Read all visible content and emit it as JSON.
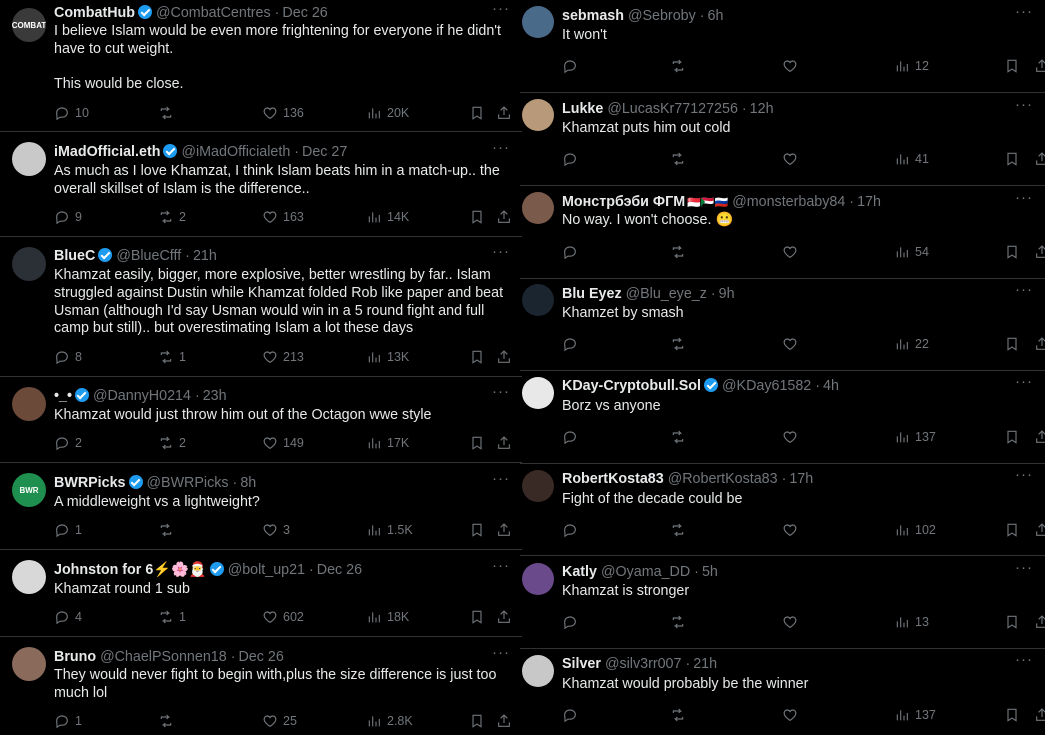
{
  "left_tweets": [
    {
      "name": "CombatHub",
      "verified": true,
      "handle": "@CombatCentres",
      "time": "Dec 26",
      "text": "I believe Islam would be even more frightening for everyone if he didn't have to cut weight.\n\nThis would be close.",
      "replies": "10",
      "retweets": "",
      "likes": "136",
      "views": "20K",
      "avatar_color": "#3a3a3a",
      "avatar_label": "COMBAT"
    },
    {
      "name": "iMadOfficial.eth",
      "verified": true,
      "handle": "@iMadOfficialeth",
      "time": "Dec 27",
      "text": "As much as I love Khamzat, I think Islam beats him in a match-up.. the overall skillset of Islam is the difference..",
      "replies": "9",
      "retweets": "2",
      "likes": "163",
      "views": "14K",
      "avatar_color": "#c9c9c9",
      "avatar_label": ""
    },
    {
      "name": "BlueC",
      "verified": true,
      "handle": "@BlueCfff",
      "time": "21h",
      "text": "Khamzat easily, bigger, more explosive, better wrestling by far.. Islam struggled against Dustin while Khamzat folded Rob like paper and beat Usman (although I'd say Usman would win in a 5 round fight and full camp but still).. but overestimating Islam a lot these days",
      "replies": "8",
      "retweets": "1",
      "likes": "213",
      "views": "13K",
      "avatar_color": "#2b2f36",
      "avatar_label": ""
    },
    {
      "name": "•_•",
      "verified": true,
      "handle": "@DannyH0214",
      "time": "23h",
      "text": "Khamzat would just throw him out of the Octagon wwe style",
      "replies": "2",
      "retweets": "2",
      "likes": "149",
      "views": "17K",
      "avatar_color": "#6b4a3a",
      "avatar_label": ""
    },
    {
      "name": "BWRPicks",
      "verified": true,
      "handle": "@BWRPicks",
      "time": "8h",
      "text": "A middleweight vs a lightweight?",
      "replies": "1",
      "retweets": "",
      "likes": "3",
      "views": "1.5K",
      "avatar_color": "#1e8f4e",
      "avatar_label": "BWR"
    },
    {
      "name": "Johnston for 6⚡🌸🎅",
      "verified": true,
      "handle": "@bolt_up21",
      "time": "Dec 26",
      "text": "Khamzat round 1 sub",
      "replies": "4",
      "retweets": "1",
      "likes": "602",
      "views": "18K",
      "avatar_color": "#d8d8d8",
      "avatar_label": ""
    },
    {
      "name": "Bruno",
      "verified": false,
      "handle": "@ChaelPSonnen18",
      "time": "Dec 26",
      "text": "They would never fight to begin with,plus the size difference is just too much lol",
      "replies": "1",
      "retweets": "",
      "likes": "25",
      "views": "2.8K",
      "avatar_color": "#8a6a5a",
      "avatar_label": ""
    }
  ],
  "right_tweets": [
    {
      "name": "sebmash",
      "verified": false,
      "handle": "@Sebroby",
      "time": "6h",
      "text": "It won't",
      "replies": "",
      "retweets": "",
      "likes": "",
      "views": "12",
      "avatar_color": "#4a6a8a",
      "flags": ""
    },
    {
      "name": "Lukke",
      "verified": false,
      "handle": "@LucasKr77127256",
      "time": "12h",
      "text": "Khamzat puts him out cold",
      "replies": "",
      "retweets": "",
      "likes": "",
      "views": "41",
      "avatar_color": "#b89a7a",
      "flags": ""
    },
    {
      "name": "Монстрбэби ФГМ",
      "verified": false,
      "handle": "@monsterbaby84",
      "time": "17h",
      "text": "No way. I won't choose. 😬",
      "replies": "",
      "retweets": "",
      "likes": "",
      "views": "54",
      "avatar_color": "#7a5a4a",
      "flags": "🇸🇬🇸🇩🇷🇺"
    },
    {
      "name": "Blu Eyez",
      "verified": false,
      "handle": "@Blu_eye_z",
      "time": "9h",
      "text": "Khamzet by smash",
      "replies": "",
      "retweets": "",
      "likes": "",
      "views": "22",
      "avatar_color": "#1a2530",
      "flags": ""
    },
    {
      "name": "KDay-Cryptobull.Sol",
      "verified": true,
      "handle": "@KDay61582",
      "time": "4h",
      "text": "Borz vs anyone",
      "replies": "",
      "retweets": "",
      "likes": "",
      "views": "137",
      "avatar_color": "#e8e8e8",
      "flags": ""
    },
    {
      "name": "RobertKosta83",
      "verified": false,
      "handle": "@RobertKosta83",
      "time": "17h",
      "text": "Fight of the decade could be",
      "replies": "",
      "retweets": "",
      "likes": "",
      "views": "102",
      "avatar_color": "#3a2a25",
      "flags": ""
    },
    {
      "name": "Katly",
      "verified": false,
      "handle": "@Oyama_DD",
      "time": "5h",
      "text": "Khamzat is stronger",
      "replies": "",
      "retweets": "",
      "likes": "",
      "views": "13",
      "avatar_color": "#6a4a8a",
      "flags": ""
    },
    {
      "name": "Silver",
      "verified": false,
      "handle": "@silv3rr007",
      "time": "21h",
      "text": "Khamzat would probably be the winner",
      "replies": "",
      "retweets": "",
      "likes": "",
      "views": "137",
      "avatar_color": "#c8c8c8",
      "flags": ""
    }
  ],
  "icons": {
    "reply": "reply-icon",
    "retweet": "retweet-icon",
    "like": "heart-icon",
    "views": "views-icon",
    "bookmark": "bookmark-icon",
    "share": "share-icon",
    "more": "more-icon"
  },
  "more_glyph": "···"
}
